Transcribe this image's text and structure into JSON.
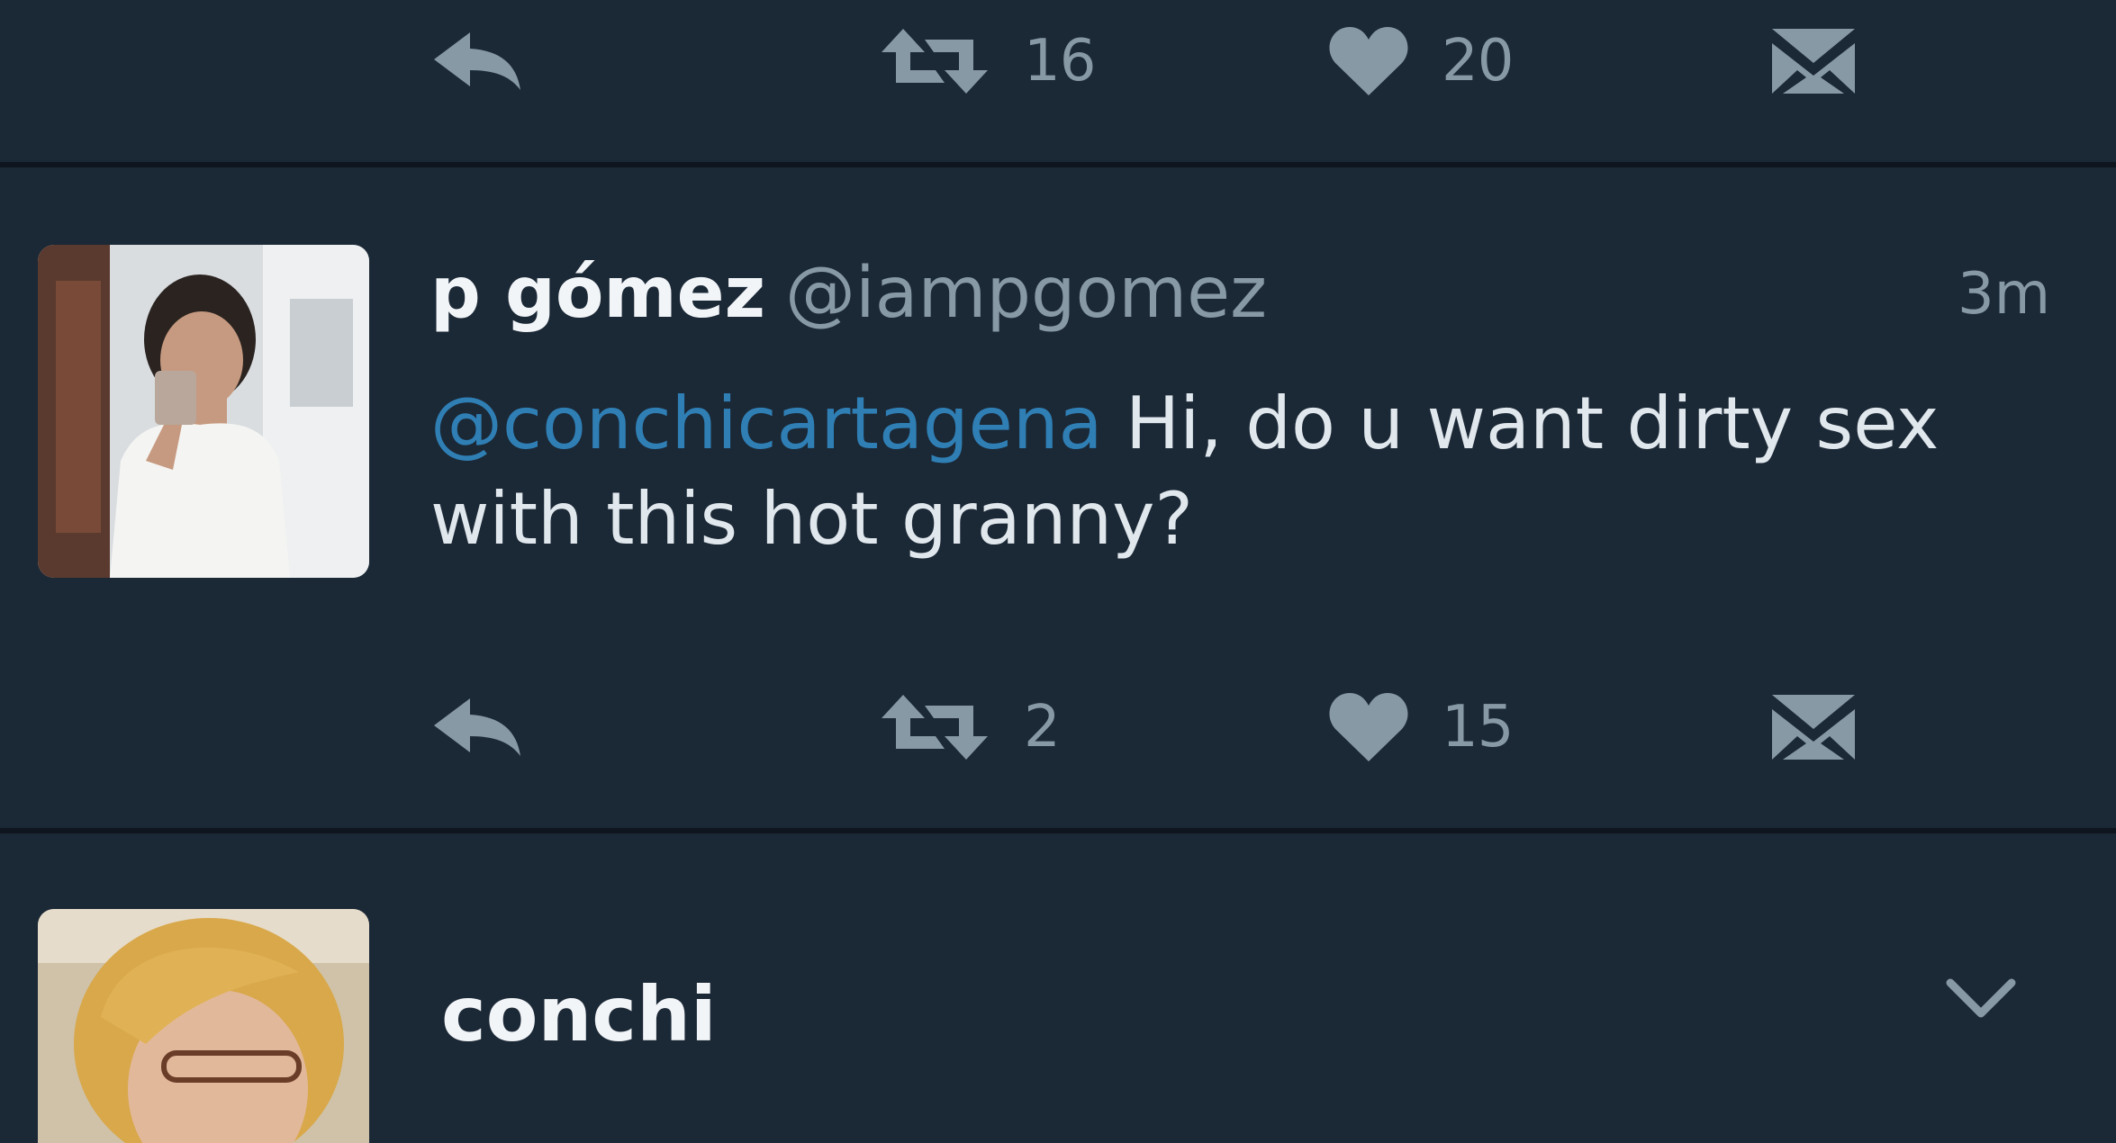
{
  "colors": {
    "background": "#1b2836",
    "divider": "#0e151e",
    "icon_gray": "#8899a6",
    "mention_blue": "#2f7fb5",
    "text": "#e1e8ed"
  },
  "top_actions": {
    "reply_icon": "reply-icon",
    "retweet_count": "16",
    "like_count": "20",
    "dm_icon": "envelope-icon"
  },
  "tweet1": {
    "avatar": "profile-photo",
    "name": "p gómez",
    "handle": "@iampgomez",
    "time": "3m",
    "mention": "@conchicartagena",
    "text": "Hi, do u want dirty sex with this hot granny?",
    "actions": {
      "retweet_count": "2",
      "like_count": "15"
    }
  },
  "tweet2": {
    "avatar": "profile-photo",
    "name": "conchi",
    "menu_icon": "chevron-down-icon"
  }
}
